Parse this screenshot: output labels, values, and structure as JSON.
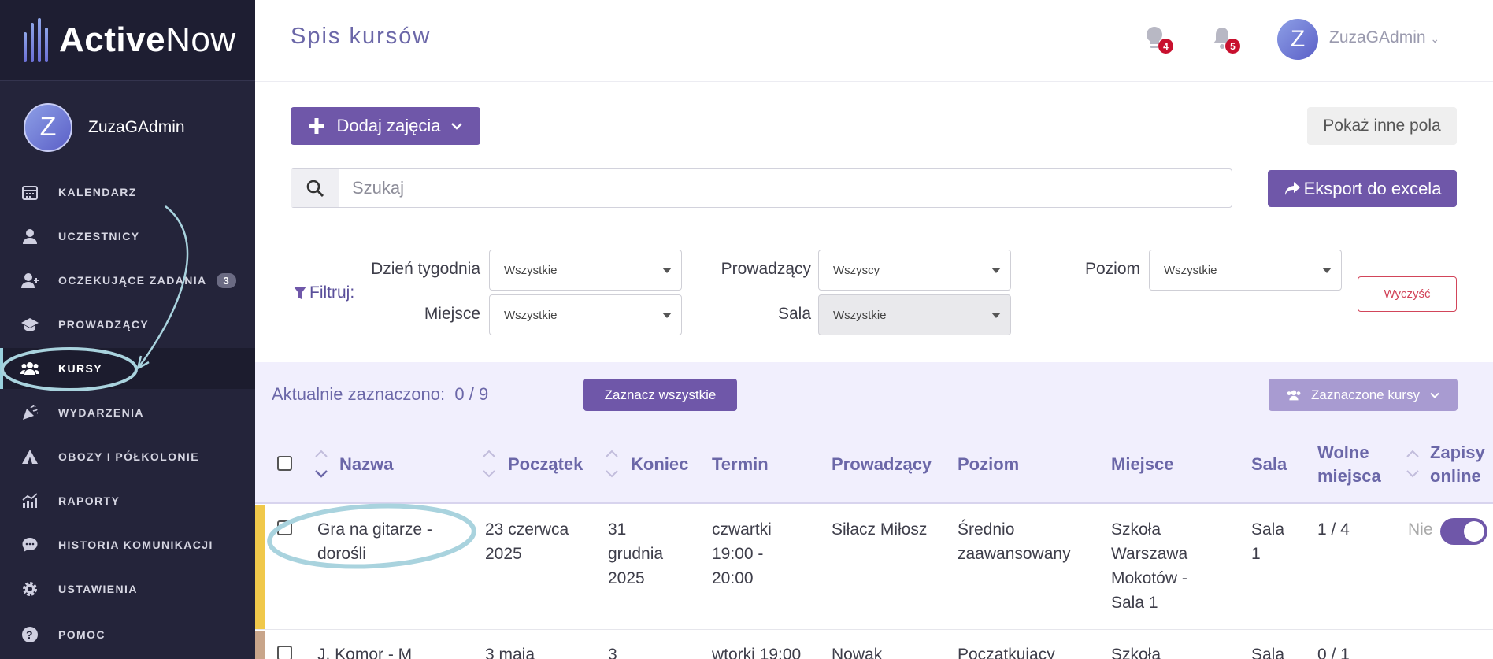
{
  "app": {
    "logo_bold": "Active",
    "logo_light": "Now"
  },
  "sidebar": {
    "user": {
      "initial": "Z",
      "name": "ZuzaGAdmin"
    },
    "items": [
      {
        "label": "KALENDARZ",
        "icon": "calendar-icon"
      },
      {
        "label": "UCZESTNICY",
        "icon": "person-icon"
      },
      {
        "label": "OCZEKUJĄCE ZADANIA",
        "icon": "person-add-icon",
        "badge": "3"
      },
      {
        "label": "PROWADZĄCY",
        "icon": "graduation-cap-icon"
      },
      {
        "label": "KURSY",
        "icon": "users-icon",
        "active": true
      },
      {
        "label": "WYDARZENIA",
        "icon": "party-popper-icon"
      },
      {
        "label": "OBOZY I PÓŁKOLONIE",
        "icon": "tent-icon"
      },
      {
        "label": "RAPORTY",
        "icon": "chart-icon"
      },
      {
        "label": "HISTORIA KOMUNIKACJI",
        "icon": "chat-icon"
      },
      {
        "label": "USTAWIENIA",
        "icon": "gear-icon"
      },
      {
        "label": "POMOC",
        "icon": "help-icon"
      }
    ]
  },
  "header": {
    "title": "Spis kursów",
    "tips_count": "4",
    "notifications_count": "5",
    "user_initial": "Z",
    "user_name": "ZuzaGAdmin"
  },
  "toolbar": {
    "add_label": "Dodaj zajęcia",
    "show_fields_label": "Pokaż inne pola",
    "search_placeholder": "Szukaj",
    "export_label": "Eksport do excela"
  },
  "filters": {
    "title": "Filtruj:",
    "day_label": "Dzień tygodnia",
    "day_value": "Wszystkie",
    "place_label": "Miejsce",
    "place_value": "Wszystkie",
    "teacher_label": "Prowadzący",
    "teacher_value": "Wszyscy",
    "room_label": "Sala",
    "room_value": "Wszystkie",
    "level_label": "Poziom",
    "level_value": "Wszystkie",
    "clear_label": "Wyczyść"
  },
  "selection": {
    "label": "Aktualnie zaznaczono:",
    "count": "0 / 9",
    "select_all_label": "Zaznacz wszystkie",
    "selected_courses_label": "Zaznaczone kursy"
  },
  "table": {
    "columns": {
      "name": "Nazwa",
      "start": "Początek",
      "end": "Koniec",
      "term": "Termin",
      "teacher": "Prowadzący",
      "level": "Poziom",
      "place": "Miejsce",
      "room": "Sala",
      "free_1": "Wolne",
      "free_2": "miejsca",
      "online_1": "Zapisy",
      "online_2": "online"
    },
    "rows": [
      {
        "marker_color": "#f0c84a",
        "name": [
          "Gra na gitarze -",
          "dorośli"
        ],
        "start": [
          "23 czerwca",
          "2025"
        ],
        "end": [
          "31",
          "grudnia",
          "2025"
        ],
        "term": [
          "czwartki",
          "19:00 -",
          "20:00"
        ],
        "teacher": "Siłacz Miłosz",
        "level": [
          "Średnio",
          "zaawansowany"
        ],
        "place": [
          "Szkoła",
          "Warszawa",
          "Mokotów -",
          "Sala 1"
        ],
        "room": [
          "Sala",
          "1"
        ],
        "free": "1 / 4",
        "online": "Nie"
      },
      {
        "marker_color": "#c8a58a",
        "name": [
          "J. Komor - M"
        ],
        "start": [
          "3 maja"
        ],
        "end": [
          "3"
        ],
        "term": [
          "wtorki 19:00"
        ],
        "teacher": "Nowak",
        "level": [
          "Początkujący"
        ],
        "place": [
          "Szkoła"
        ],
        "room": [
          "Sala"
        ],
        "free": "0 / 1",
        "online": ""
      }
    ]
  },
  "colors": {
    "accent": "#6f57a9",
    "sidebar": "#24243a",
    "annotation": "#a9d3de"
  }
}
